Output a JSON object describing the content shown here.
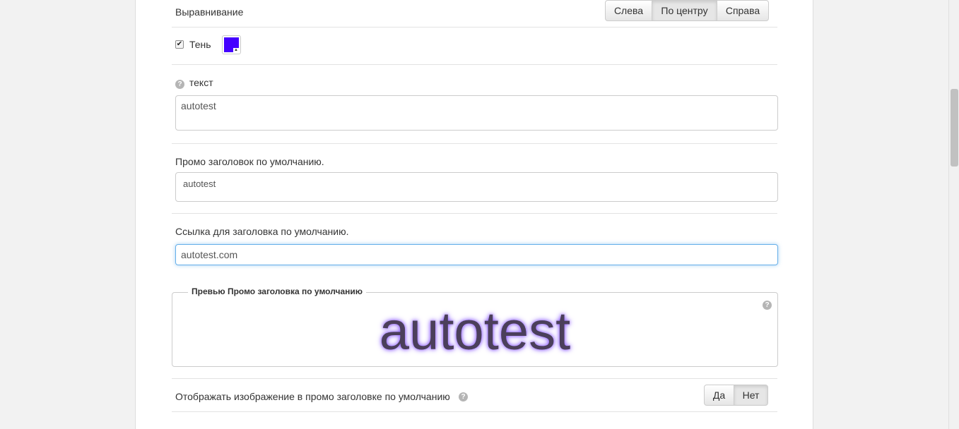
{
  "alignment": {
    "label": "Выравнивание",
    "options": [
      "Слева",
      "По центру",
      "Справа"
    ],
    "selected": "По центру"
  },
  "shadow": {
    "checkbox_label": "Тень",
    "checked": true,
    "color": "#4400ff"
  },
  "text_field": {
    "label": "текст",
    "value": "autotest"
  },
  "promo_title": {
    "label": "Промо заголовок по умолчанию.",
    "value": "autotest"
  },
  "title_link": {
    "label": "Ссылка для заголовка по умолчанию.",
    "value": "autotest.com"
  },
  "preview": {
    "legend": "Превью Промо заголовка по умолчанию",
    "text": "autotest",
    "shadow_color": "#8a5cff"
  },
  "show_image": {
    "label": "Отображать изображение в промо заголовке по умолчанию",
    "options": [
      "Да",
      "Нет"
    ],
    "selected": "Нет"
  }
}
